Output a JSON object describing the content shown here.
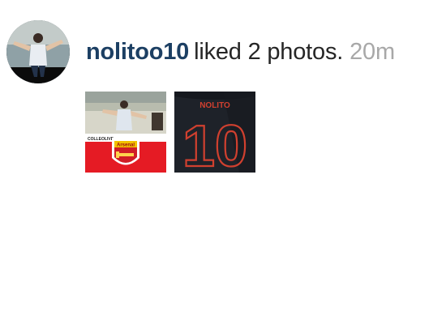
{
  "notification": {
    "username": "nolitoo10",
    "action": "liked 2 photos.",
    "time": "20m",
    "avatar_icon": "profile-photo-icon",
    "photos": [
      {
        "name": "liked-photo-1",
        "caption_small": "COLLEOLIVE",
        "badge_text": "Arsenal",
        "colors": {
          "top": "#d7d6c9",
          "banner": "#e51b24",
          "stripe": "#ffffff"
        }
      },
      {
        "name": "liked-photo-2",
        "name_text": "NOLITO",
        "number_text": "10",
        "colors": {
          "jersey": "#1e2229",
          "text": "#d0402f"
        }
      }
    ]
  }
}
